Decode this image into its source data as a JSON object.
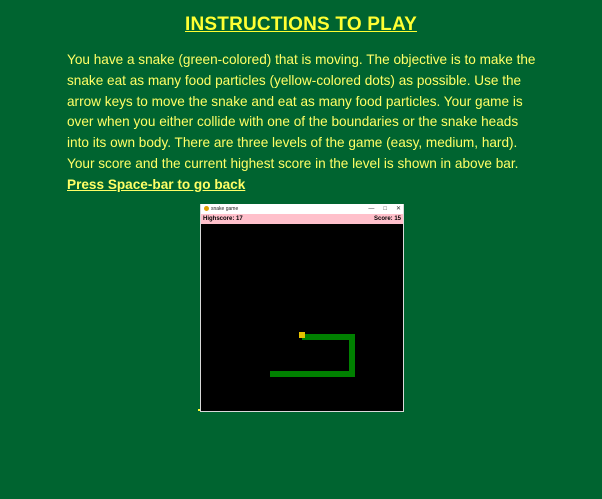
{
  "page": {
    "title": "INSTRUCTIONS TO PLAY",
    "instructions_text": "You have a snake (green-colored) that is moving. The objective is to make the snake eat as many food particles (yellow-colored dots) as possible. Use the arrow keys to move the snake and eat as many food particles. Your game is over when you either collide with one of the boundaries or the snake heads into its own body. There are three levels of the game (easy, medium, hard). Your score and the current highest score in the level is shown in above bar.",
    "back_hint": "Press Space-bar to go back"
  },
  "game_window": {
    "window_title": "snake game",
    "controls": [
      "—",
      "□",
      "✕"
    ],
    "highscore_label": "Highscore: 17",
    "score_label": "Score: 15",
    "colors": {
      "background": "#000000",
      "snake": "#008000",
      "food": "#e6c200",
      "scorebar": "#ffc0cb"
    }
  },
  "colors": {
    "page_background": "#006430",
    "text": "#ffff66",
    "title": "#ffff33"
  }
}
